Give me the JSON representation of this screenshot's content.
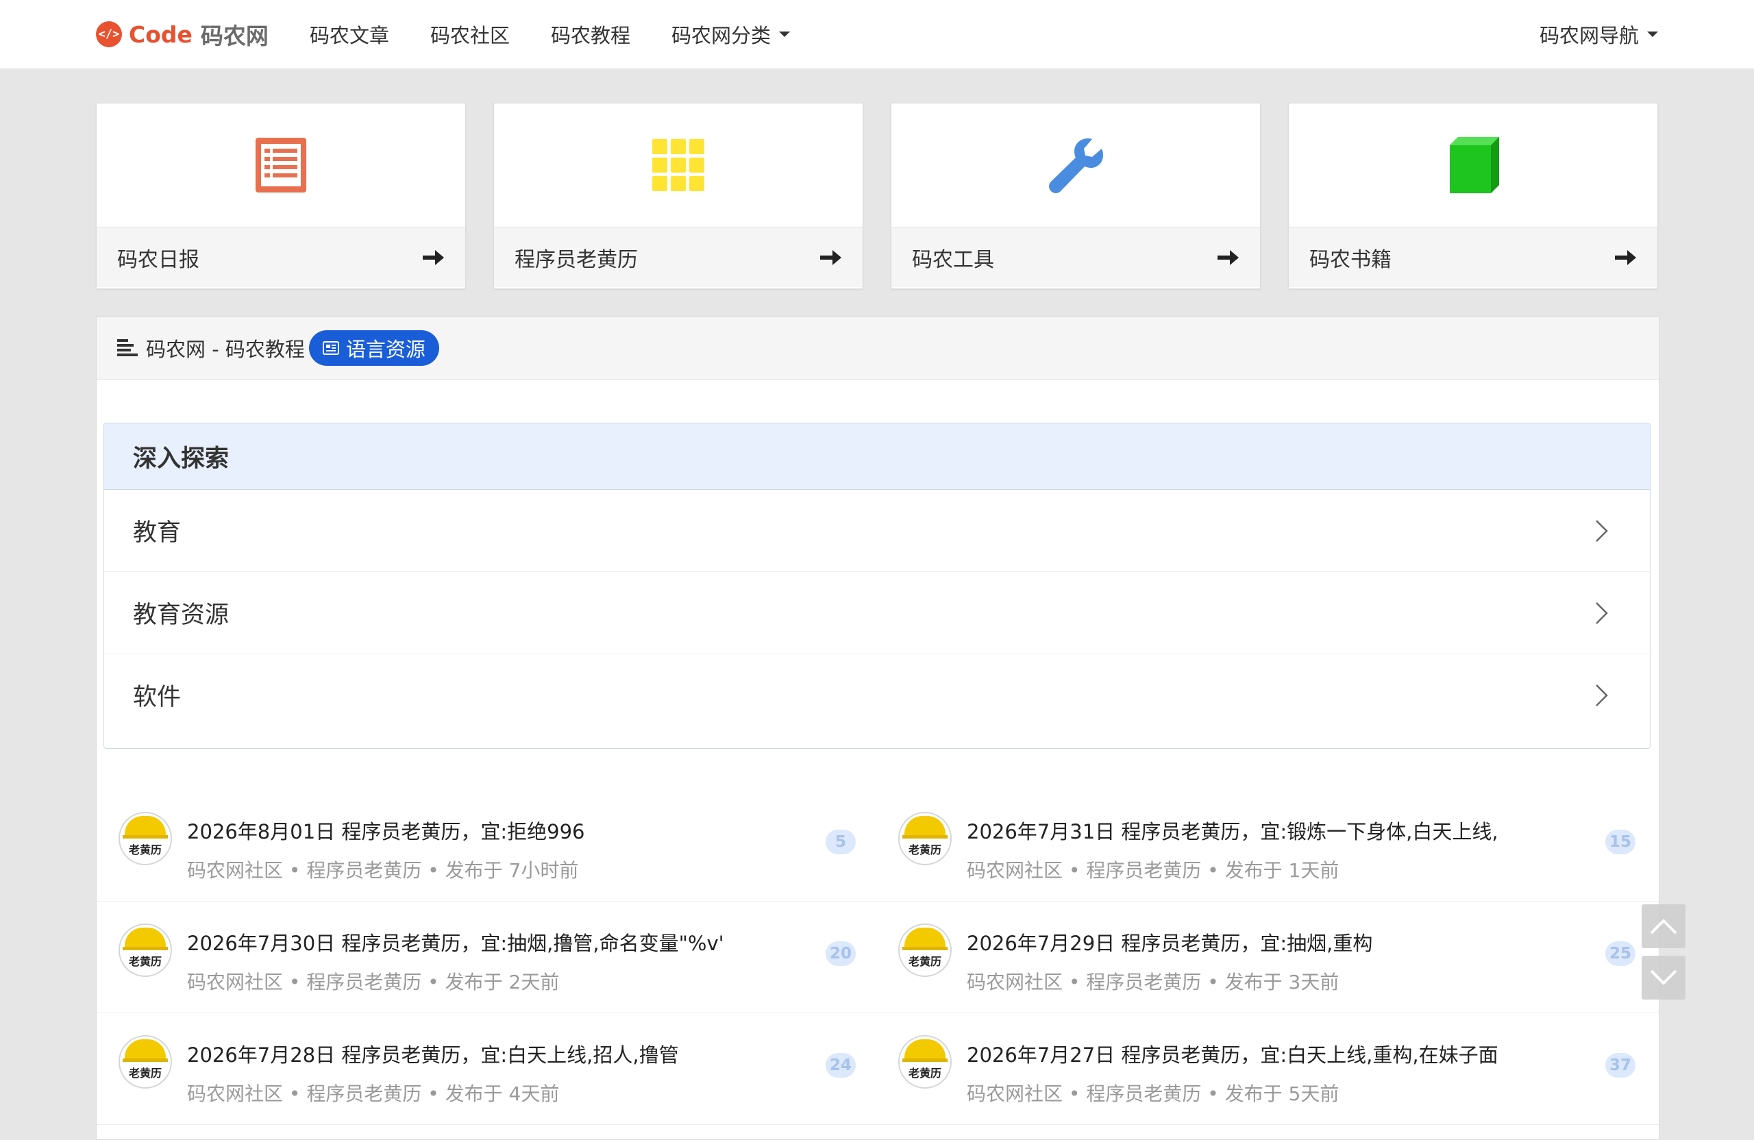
{
  "header": {
    "brand_logo": "</>",
    "brand_code": "Code",
    "brand_name": "码农网",
    "nav": [
      "码农文章",
      "码农社区",
      "码农教程",
      "码农网分类"
    ],
    "nav_right": "码农网导航"
  },
  "cards": [
    {
      "label": "码农日报",
      "icon": "list-icon",
      "color": "#e8704f"
    },
    {
      "label": "程序员老黄历",
      "icon": "grid-icon",
      "color": "#ffe434"
    },
    {
      "label": "码农工具",
      "icon": "wrench-icon",
      "color": "#4a8de0"
    },
    {
      "label": "码农书籍",
      "icon": "book-icon",
      "color": "#1ec51e"
    }
  ],
  "panel": {
    "title": "码农网 - 码农教程",
    "tag": "语言资源"
  },
  "explore": {
    "title": "深入探索",
    "items": [
      "教育",
      "教育资源",
      "软件"
    ]
  },
  "posts": [
    {
      "avatar": "老黄历",
      "title": "2026年8月01日 程序员老黄历，宜:拒绝996",
      "meta": "码农网社区 • 程序员老黄历 • 发布于 7小时前",
      "count": "5"
    },
    {
      "avatar": "老黄历",
      "title": "2026年7月31日 程序员老黄历，宜:锻炼一下身体,白天上线,",
      "meta": "码农网社区 • 程序员老黄历 • 发布于 1天前",
      "count": "15"
    },
    {
      "avatar": "老黄历",
      "title": "2026年7月30日 程序员老黄历，宜:抽烟,撸管,命名变量\"%v'",
      "meta": "码农网社区 • 程序员老黄历 • 发布于 2天前",
      "count": "20"
    },
    {
      "avatar": "老黄历",
      "title": "2026年7月29日 程序员老黄历，宜:抽烟,重构",
      "meta": "码农网社区 • 程序员老黄历 • 发布于 3天前",
      "count": "25"
    },
    {
      "avatar": "老黄历",
      "title": "2026年7月28日 程序员老黄历，宜:白天上线,招人,撸管",
      "meta": "码农网社区 • 程序员老黄历 • 发布于 4天前",
      "count": "24"
    },
    {
      "avatar": "老黄历",
      "title": "2026年7月27日 程序员老黄历，宜:白天上线,重构,在妹子面",
      "meta": "码农网社区 • 程序员老黄历 • 发布于 5天前",
      "count": "37"
    }
  ]
}
